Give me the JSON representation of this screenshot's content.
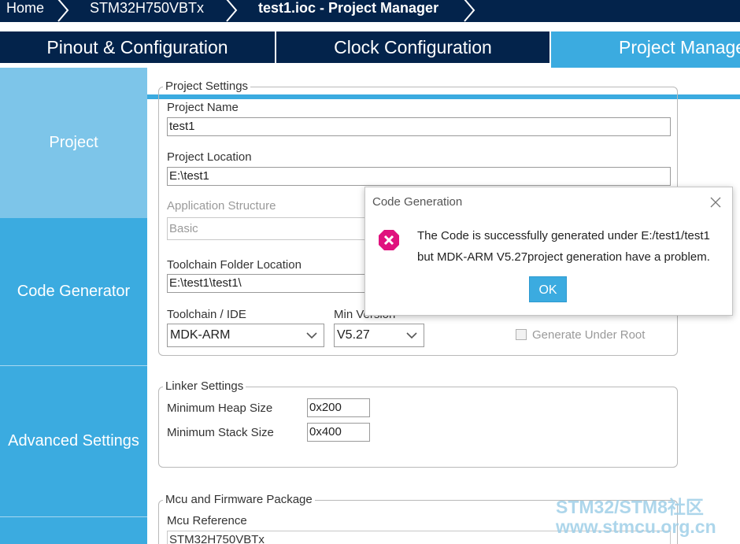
{
  "breadcrumb": {
    "home": "Home",
    "device": "STM32H750VBTx",
    "project": "test1.ioc - Project Manager"
  },
  "tabs": [
    {
      "label": "Pinout & Configuration"
    },
    {
      "label": "Clock Configuration"
    },
    {
      "label": "Project Manager"
    }
  ],
  "sidebar": {
    "items": [
      {
        "label": "Project"
      },
      {
        "label": "Code Generator"
      },
      {
        "label": "Advanced Settings"
      }
    ]
  },
  "project_settings": {
    "legend": "Project Settings",
    "project_name_label": "Project Name",
    "project_name_value": "test1",
    "project_location_label": "Project Location",
    "project_location_value": "E:\\test1",
    "app_structure_label": "Application Structure",
    "app_structure_value": "Basic",
    "toolchain_folder_label": "Toolchain Folder Location",
    "toolchain_folder_value": "E:\\test1\\test1\\",
    "toolchain_ide_label": "Toolchain / IDE",
    "toolchain_ide_value": "MDK-ARM",
    "min_version_label": "Min Version",
    "min_version_value": "V5.27",
    "generate_under_root_label": "Generate Under Root"
  },
  "linker_settings": {
    "legend": "Linker Settings",
    "heap_label": "Minimum Heap Size",
    "heap_value": "0x200",
    "stack_label": "Minimum Stack Size",
    "stack_value": "0x400"
  },
  "mcu_package": {
    "legend": "Mcu and Firmware Package",
    "mcu_reference_label": "Mcu Reference",
    "mcu_reference_value": "STM32H750VBTx"
  },
  "dialog": {
    "title": "Code Generation",
    "message_line1": "The Code is successfully generated under E:/test1/test1",
    "message_line2": "but MDK-ARM V5.27project generation have a problem.",
    "ok_label": "OK",
    "icon": "error-icon"
  },
  "watermark": {
    "line1": "STM32/STM8社区",
    "line2": "www.stmcu.org.cn"
  },
  "colors": {
    "navy": "#03234b",
    "accent": "#3babe0",
    "sidebar_active": "#7dc5e9",
    "error": "#e0127e"
  }
}
